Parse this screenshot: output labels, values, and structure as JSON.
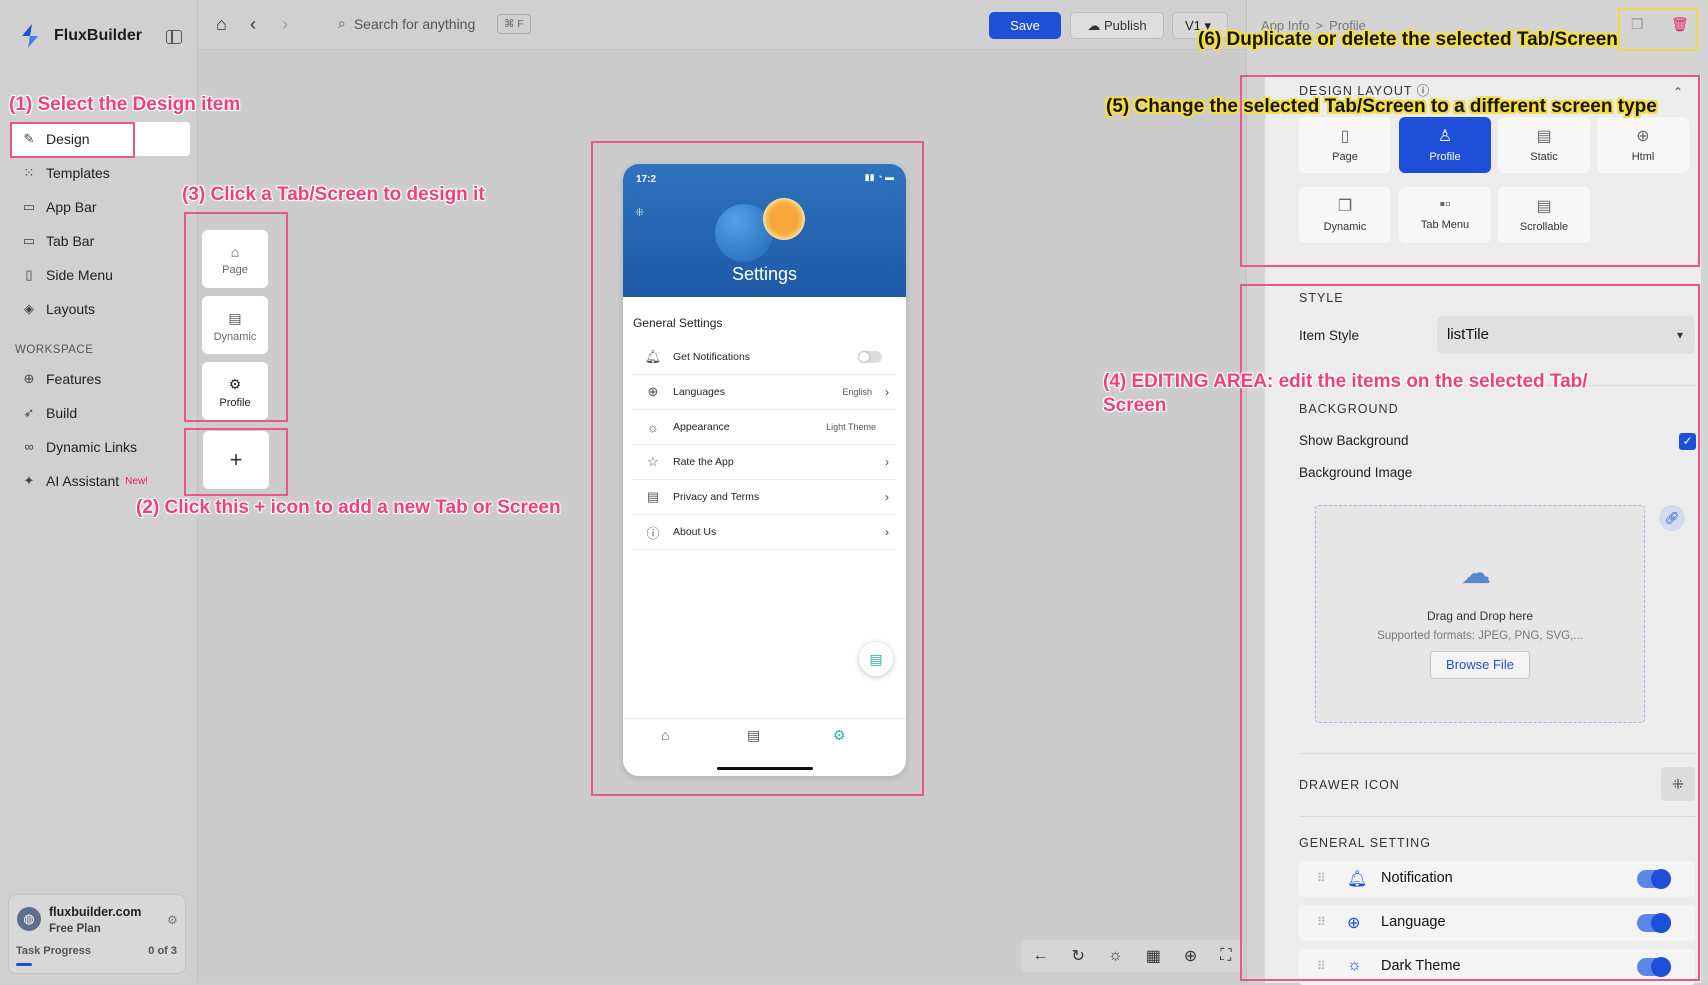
{
  "app": {
    "name": "FluxBuilder"
  },
  "sidebar": {
    "items": [
      {
        "label": "Design",
        "icon": "brush-icon"
      },
      {
        "label": "Templates",
        "icon": "grid-icon"
      },
      {
        "label": "App Bar",
        "icon": "appbar-icon"
      },
      {
        "label": "Tab Bar",
        "icon": "tabbar-icon"
      },
      {
        "label": "Side Menu",
        "icon": "sidemenu-icon"
      },
      {
        "label": "Layouts",
        "icon": "layers-icon"
      }
    ],
    "workspace_title": "WORKSPACE",
    "workspace_items": [
      {
        "label": "Features",
        "icon": "features-icon"
      },
      {
        "label": "Build",
        "icon": "rocket-icon"
      },
      {
        "label": "Dynamic Links",
        "icon": "link-icon"
      },
      {
        "label": "AI Assistant",
        "icon": "sparkle-icon",
        "badge": "New!"
      }
    ],
    "plan": {
      "domain": "fluxbuilder.com",
      "name": "Free Plan",
      "task_label": "Task Progress",
      "task_count": "0 of 3",
      "task_progress": 0.1
    }
  },
  "topbar": {
    "search_placeholder": "Search for anything",
    "shortcut": "⌘ F",
    "save": "Save",
    "publish": "Publish",
    "version": "V1"
  },
  "screens": [
    {
      "label": "Page",
      "icon": "home-icon"
    },
    {
      "label": "Dynamic",
      "icon": "stack-icon"
    },
    {
      "label": "Profile",
      "icon": "profile-gear-icon"
    }
  ],
  "phone": {
    "time": "17:2",
    "hero_title": "Settings",
    "section": "General Settings",
    "rows": [
      {
        "label": "Get Notifications",
        "value": "",
        "icon": "bell-icon",
        "control": "toggle"
      },
      {
        "label": "Languages",
        "value": "English",
        "icon": "globe-icon",
        "control": "chevron"
      },
      {
        "label": "Appearance",
        "value": "Light Theme",
        "icon": "sun-icon",
        "control": "none"
      },
      {
        "label": "Rate the App",
        "value": "",
        "icon": "star-icon",
        "control": "chevron"
      },
      {
        "label": "Privacy and Terms",
        "value": "",
        "icon": "document-icon",
        "control": "chevron"
      },
      {
        "label": "About Us",
        "value": "",
        "icon": "info-icon",
        "control": "chevron"
      }
    ]
  },
  "panel": {
    "breadcrumb_root": "App Info",
    "breadcrumb_sep": ">",
    "breadcrumb_current": "Profile",
    "design_layout_title": "DESIGN LAYOUT",
    "layouts": [
      {
        "label": "Page",
        "selected": false
      },
      {
        "label": "Profile",
        "selected": true
      },
      {
        "label": "Static",
        "selected": false
      },
      {
        "label": "Html",
        "selected": false
      },
      {
        "label": "Dynamic",
        "selected": false
      },
      {
        "label": "Tab Menu",
        "selected": false
      },
      {
        "label": "Scrollable",
        "selected": false
      }
    ],
    "style_title": "STYLE",
    "item_style_label": "Item Style",
    "item_style_value": "listTile",
    "background_title": "BACKGROUND",
    "show_background_label": "Show Background",
    "show_background_checked": true,
    "background_image_label": "Background Image",
    "dropzone_title": "Drag and Drop here",
    "dropzone_formats": "Supported formats: JPEG, PNG, SVG,...",
    "browse_label": "Browse File",
    "drawer_icon_title": "DRAWER ICON",
    "general_setting_title": "GENERAL SETTING",
    "general_settings": [
      {
        "label": "Notification",
        "icon": "bell-icon",
        "enabled": true
      },
      {
        "label": "Language",
        "icon": "globe-icon",
        "enabled": true
      },
      {
        "label": "Dark Theme",
        "icon": "sun-icon",
        "enabled": true
      }
    ]
  },
  "annotations": {
    "n1": "(1) Select the Design item",
    "n2": "(2) Click this + icon to add a new Tab or Screen",
    "n3": "(3) Click a Tab/Screen to design it",
    "n4": "(4) EDITING AREA: edit the items on the selected Tab/ Screen",
    "n5": "(5) Change the selected Tab/Screen to a different screen type",
    "n6": "(6) Duplicate or delete the selected Tab/Screen"
  },
  "colors": {
    "accent": "#1d4fd8",
    "annotation": "#e8578a",
    "annotation_yellow": "#f2d64b"
  }
}
